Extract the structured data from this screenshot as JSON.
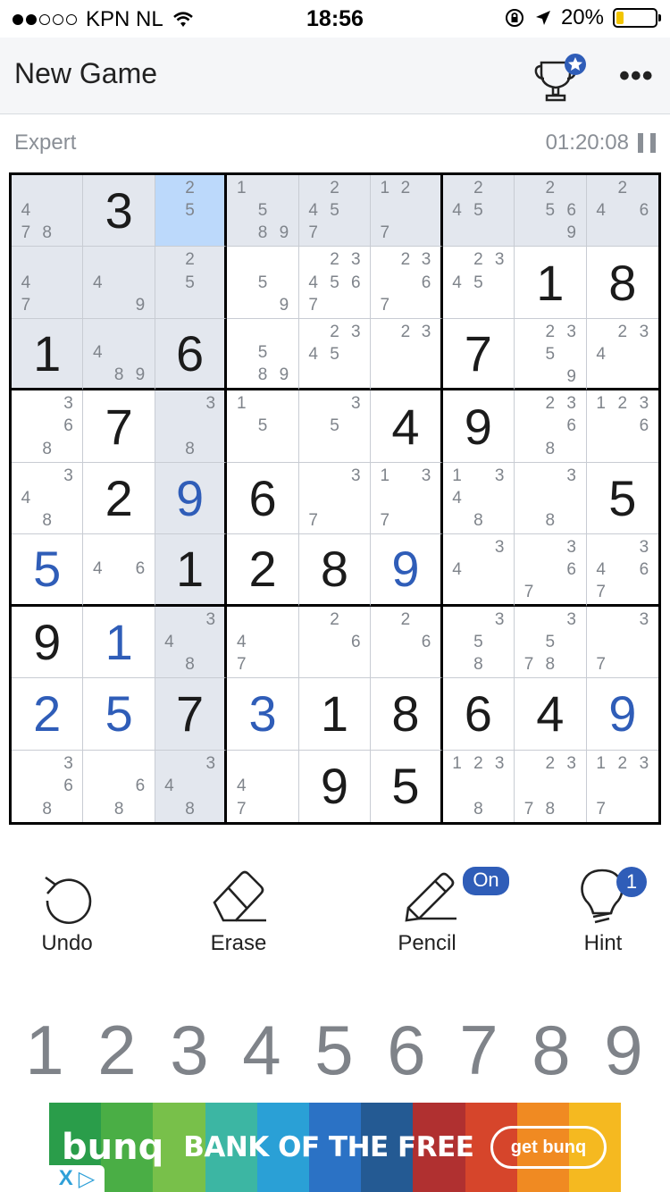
{
  "status_bar": {
    "carrier": "KPN NL",
    "time": "18:56",
    "battery": "20%"
  },
  "nav": {
    "title": "New Game",
    "more_label": "•••"
  },
  "info": {
    "difficulty": "Expert",
    "timer": "01:20:08"
  },
  "colors": {
    "accent": "#2f5db8",
    "highlight": "#e3e7ee",
    "selected": "#bcd9fb"
  },
  "board": {
    "rows": [
      [
        {
          "n": "4 7 8"
        },
        {
          "v": "3",
          "t": "given"
        },
        {
          "n": "2 5"
        },
        {
          "n": "1 5 8 9"
        },
        {
          "n": "2 4 5 7"
        },
        {
          "n": "1 2 7"
        },
        {
          "n": "2 4 5"
        },
        {
          "n": "2 5 6 9"
        },
        {
          "n": "2 4 6"
        }
      ],
      [
        {
          "n": "4 7"
        },
        {
          "n": "4 9"
        },
        {
          "n": "2 5"
        },
        {
          "n": "5 9"
        },
        {
          "n": "2 3 4 5 6 7"
        },
        {
          "n": "2 3 6 7"
        },
        {
          "n": "2 3 4 5"
        },
        {
          "v": "1",
          "t": "given"
        },
        {
          "v": "8",
          "t": "given"
        }
      ],
      [
        {
          "v": "1",
          "t": "given"
        },
        {
          "n": "4 8 9"
        },
        {
          "v": "6",
          "t": "given"
        },
        {
          "n": "5 8 9"
        },
        {
          "n": "2 3 4 5"
        },
        {
          "n": "2 3"
        },
        {
          "v": "7",
          "t": "given"
        },
        {
          "n": "2 3 5 9"
        },
        {
          "n": "2 3 4"
        }
      ],
      [
        {
          "n": "3 6 8"
        },
        {
          "v": "7",
          "t": "given"
        },
        {
          "n": "3 8"
        },
        {
          "n": "1 5"
        },
        {
          "n": "3 5"
        },
        {
          "v": "4",
          "t": "given"
        },
        {
          "v": "9",
          "t": "given"
        },
        {
          "n": "2 3 6 8"
        },
        {
          "n": "1 2 3 6"
        }
      ],
      [
        {
          "n": "3 4 8"
        },
        {
          "v": "2",
          "t": "given"
        },
        {
          "v": "9",
          "t": "user"
        },
        {
          "v": "6",
          "t": "given"
        },
        {
          "n": "3 7"
        },
        {
          "n": "1 3 7"
        },
        {
          "n": "1 3 4 8"
        },
        {
          "n": "3 8"
        },
        {
          "v": "5",
          "t": "given"
        }
      ],
      [
        {
          "v": "5",
          "t": "user"
        },
        {
          "n": "4 6"
        },
        {
          "v": "1",
          "t": "given"
        },
        {
          "v": "2",
          "t": "given"
        },
        {
          "v": "8",
          "t": "given"
        },
        {
          "v": "9",
          "t": "user"
        },
        {
          "n": "3 4"
        },
        {
          "n": "3 6 7"
        },
        {
          "n": "3 4 6 7"
        }
      ],
      [
        {
          "v": "9",
          "t": "given"
        },
        {
          "v": "1",
          "t": "user"
        },
        {
          "n": "3 4 8"
        },
        {
          "n": "4 7"
        },
        {
          "n": "2 6"
        },
        {
          "n": "2 6"
        },
        {
          "n": "3 5 8"
        },
        {
          "n": "3 5 7 8"
        },
        {
          "n": "3 7"
        }
      ],
      [
        {
          "v": "2",
          "t": "user"
        },
        {
          "v": "5",
          "t": "user"
        },
        {
          "v": "7",
          "t": "given"
        },
        {
          "v": "3",
          "t": "user"
        },
        {
          "v": "1",
          "t": "given"
        },
        {
          "v": "8",
          "t": "given"
        },
        {
          "v": "6",
          "t": "given"
        },
        {
          "v": "4",
          "t": "given"
        },
        {
          "v": "9",
          "t": "user"
        }
      ],
      [
        {
          "n": "3 6 8"
        },
        {
          "n": "6 8"
        },
        {
          "n": "3 4 8"
        },
        {
          "n": "4 7"
        },
        {
          "v": "9",
          "t": "given"
        },
        {
          "v": "5",
          "t": "given"
        },
        {
          "n": "1 2 3 8"
        },
        {
          "n": "2 3 7 8"
        },
        {
          "n": "1 2 3 7"
        }
      ]
    ]
  },
  "tools": {
    "undo": "Undo",
    "erase": "Erase",
    "pencil": "Pencil",
    "pencil_badge": "On",
    "hint": "Hint",
    "hint_badge": "1"
  },
  "numpad": [
    "1",
    "2",
    "3",
    "4",
    "5",
    "6",
    "7",
    "8",
    "9"
  ],
  "ad": {
    "brand": "bunq",
    "slogan": "BANK OF THE FREE",
    "cta": "get bunq",
    "close": "X",
    "choices": "▷",
    "stripes": [
      "#2a9d4a",
      "#4aae45",
      "#78c04a",
      "#3cb6a3",
      "#2aa0d6",
      "#2b72c5",
      "#245a93",
      "#b03030",
      "#d6452b",
      "#f08a22",
      "#f5b920"
    ]
  }
}
